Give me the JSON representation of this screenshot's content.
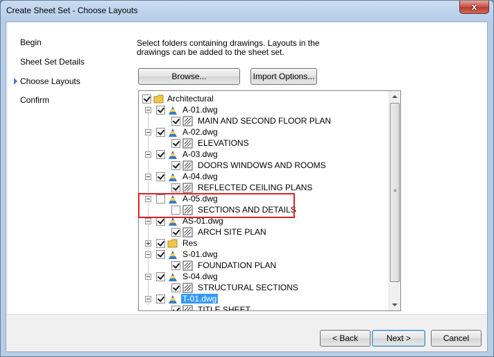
{
  "window": {
    "title": "Create Sheet Set - Choose Layouts",
    "close_label": "x"
  },
  "nav": {
    "items": [
      {
        "label": "Begin",
        "current": false
      },
      {
        "label": "Sheet Set Details",
        "current": false
      },
      {
        "label": "Choose Layouts",
        "current": true
      },
      {
        "label": "Confirm",
        "current": false
      }
    ]
  },
  "instructions": "Select folders containing drawings.  Layouts in the drawings can be added to the sheet set.",
  "buttons": {
    "browse": "Browse...",
    "import_options": "Import Options...",
    "back": "< Back",
    "next": "Next >",
    "cancel": "Cancel"
  },
  "tree": {
    "root": {
      "label": "Architectural",
      "checked": true
    },
    "nodes": [
      {
        "label": "A-01.dwg",
        "checked": true,
        "layout": "MAIN AND SECOND FLOOR PLAN",
        "layout_checked": true
      },
      {
        "label": "A-02.dwg",
        "checked": true,
        "layout": "ELEVATIONS",
        "layout_checked": true
      },
      {
        "label": "A-03.dwg",
        "checked": true,
        "layout": "DOORS WINDOWS AND ROOMS",
        "layout_checked": true
      },
      {
        "label": "A-04.dwg",
        "checked": true,
        "layout": "REFLECTED CEILING PLANS",
        "layout_checked": true
      },
      {
        "label": "A-05.dwg",
        "checked": false,
        "layout": "SECTIONS AND DETAILS",
        "layout_checked": false
      },
      {
        "label": "AS-01.dwg",
        "checked": true,
        "layout": "ARCH SITE PLAN",
        "layout_checked": true
      }
    ],
    "res_folder": {
      "label": "Res",
      "checked": true
    },
    "structural": [
      {
        "label": "S-01.dwg",
        "checked": true,
        "layout": "FOUNDATION PLAN",
        "layout_checked": true
      },
      {
        "label": "S-04.dwg",
        "checked": true,
        "layout": "STRUCTURAL SECTIONS",
        "layout_checked": true
      }
    ],
    "selected": {
      "label": "T-01.dwg",
      "checked": true,
      "layout": "TITLE SHEET",
      "layout_checked": true
    }
  },
  "colors": {
    "highlight_box": "#e02020",
    "selection": "#3399ff"
  }
}
